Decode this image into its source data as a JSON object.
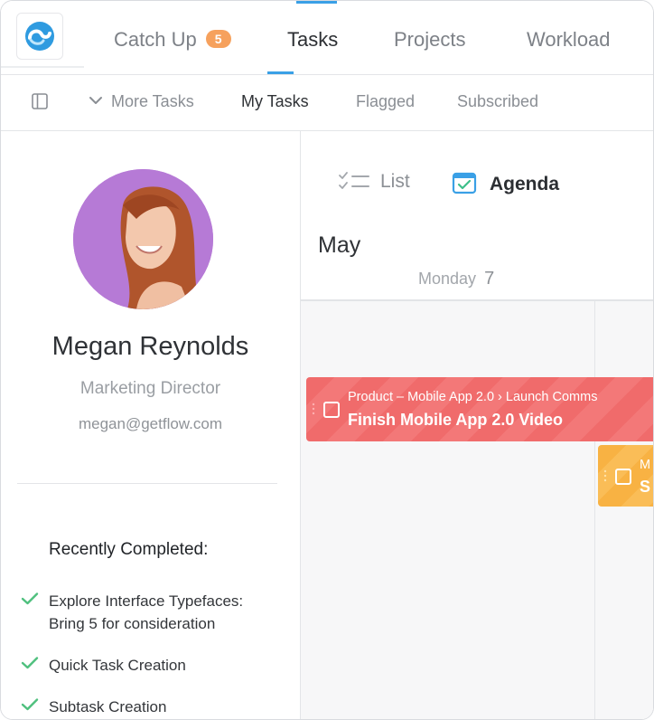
{
  "nav": {
    "tabs": [
      {
        "label": "Catch Up",
        "badge": "5"
      },
      {
        "label": "Tasks"
      },
      {
        "label": "Projects"
      },
      {
        "label": "Workload"
      }
    ]
  },
  "subnav": {
    "items": [
      {
        "label": "More Tasks"
      },
      {
        "label": "My Tasks"
      },
      {
        "label": "Flagged"
      },
      {
        "label": "Subscribed"
      }
    ]
  },
  "profile": {
    "name": "Megan Reynolds",
    "role": "Marketing Director",
    "email": "megan@getflow.com",
    "recent_title": "Recently Completed:",
    "completed": [
      {
        "text": "Explore Interface Typefaces: Bring 5 for consideration"
      },
      {
        "text": "Quick Task Creation"
      },
      {
        "text": "Subtask Creation"
      }
    ]
  },
  "calendar": {
    "views": {
      "list_label": "List",
      "agenda_label": "Agenda"
    },
    "month": "May",
    "day_name": "Monday",
    "day_number": "7",
    "events": [
      {
        "crumb": "Product – Mobile App 2.0 › Launch Comms",
        "title": "Finish Mobile App 2.0 Video",
        "color": "#f06b6b"
      },
      {
        "crumb": "M",
        "title": "S",
        "color": "#f8b243"
      }
    ]
  },
  "colors": {
    "accent": "#3aa0e6",
    "badge": "#f6a15d",
    "check": "#4fc07e",
    "avatar_bg": "#b67ad6"
  }
}
